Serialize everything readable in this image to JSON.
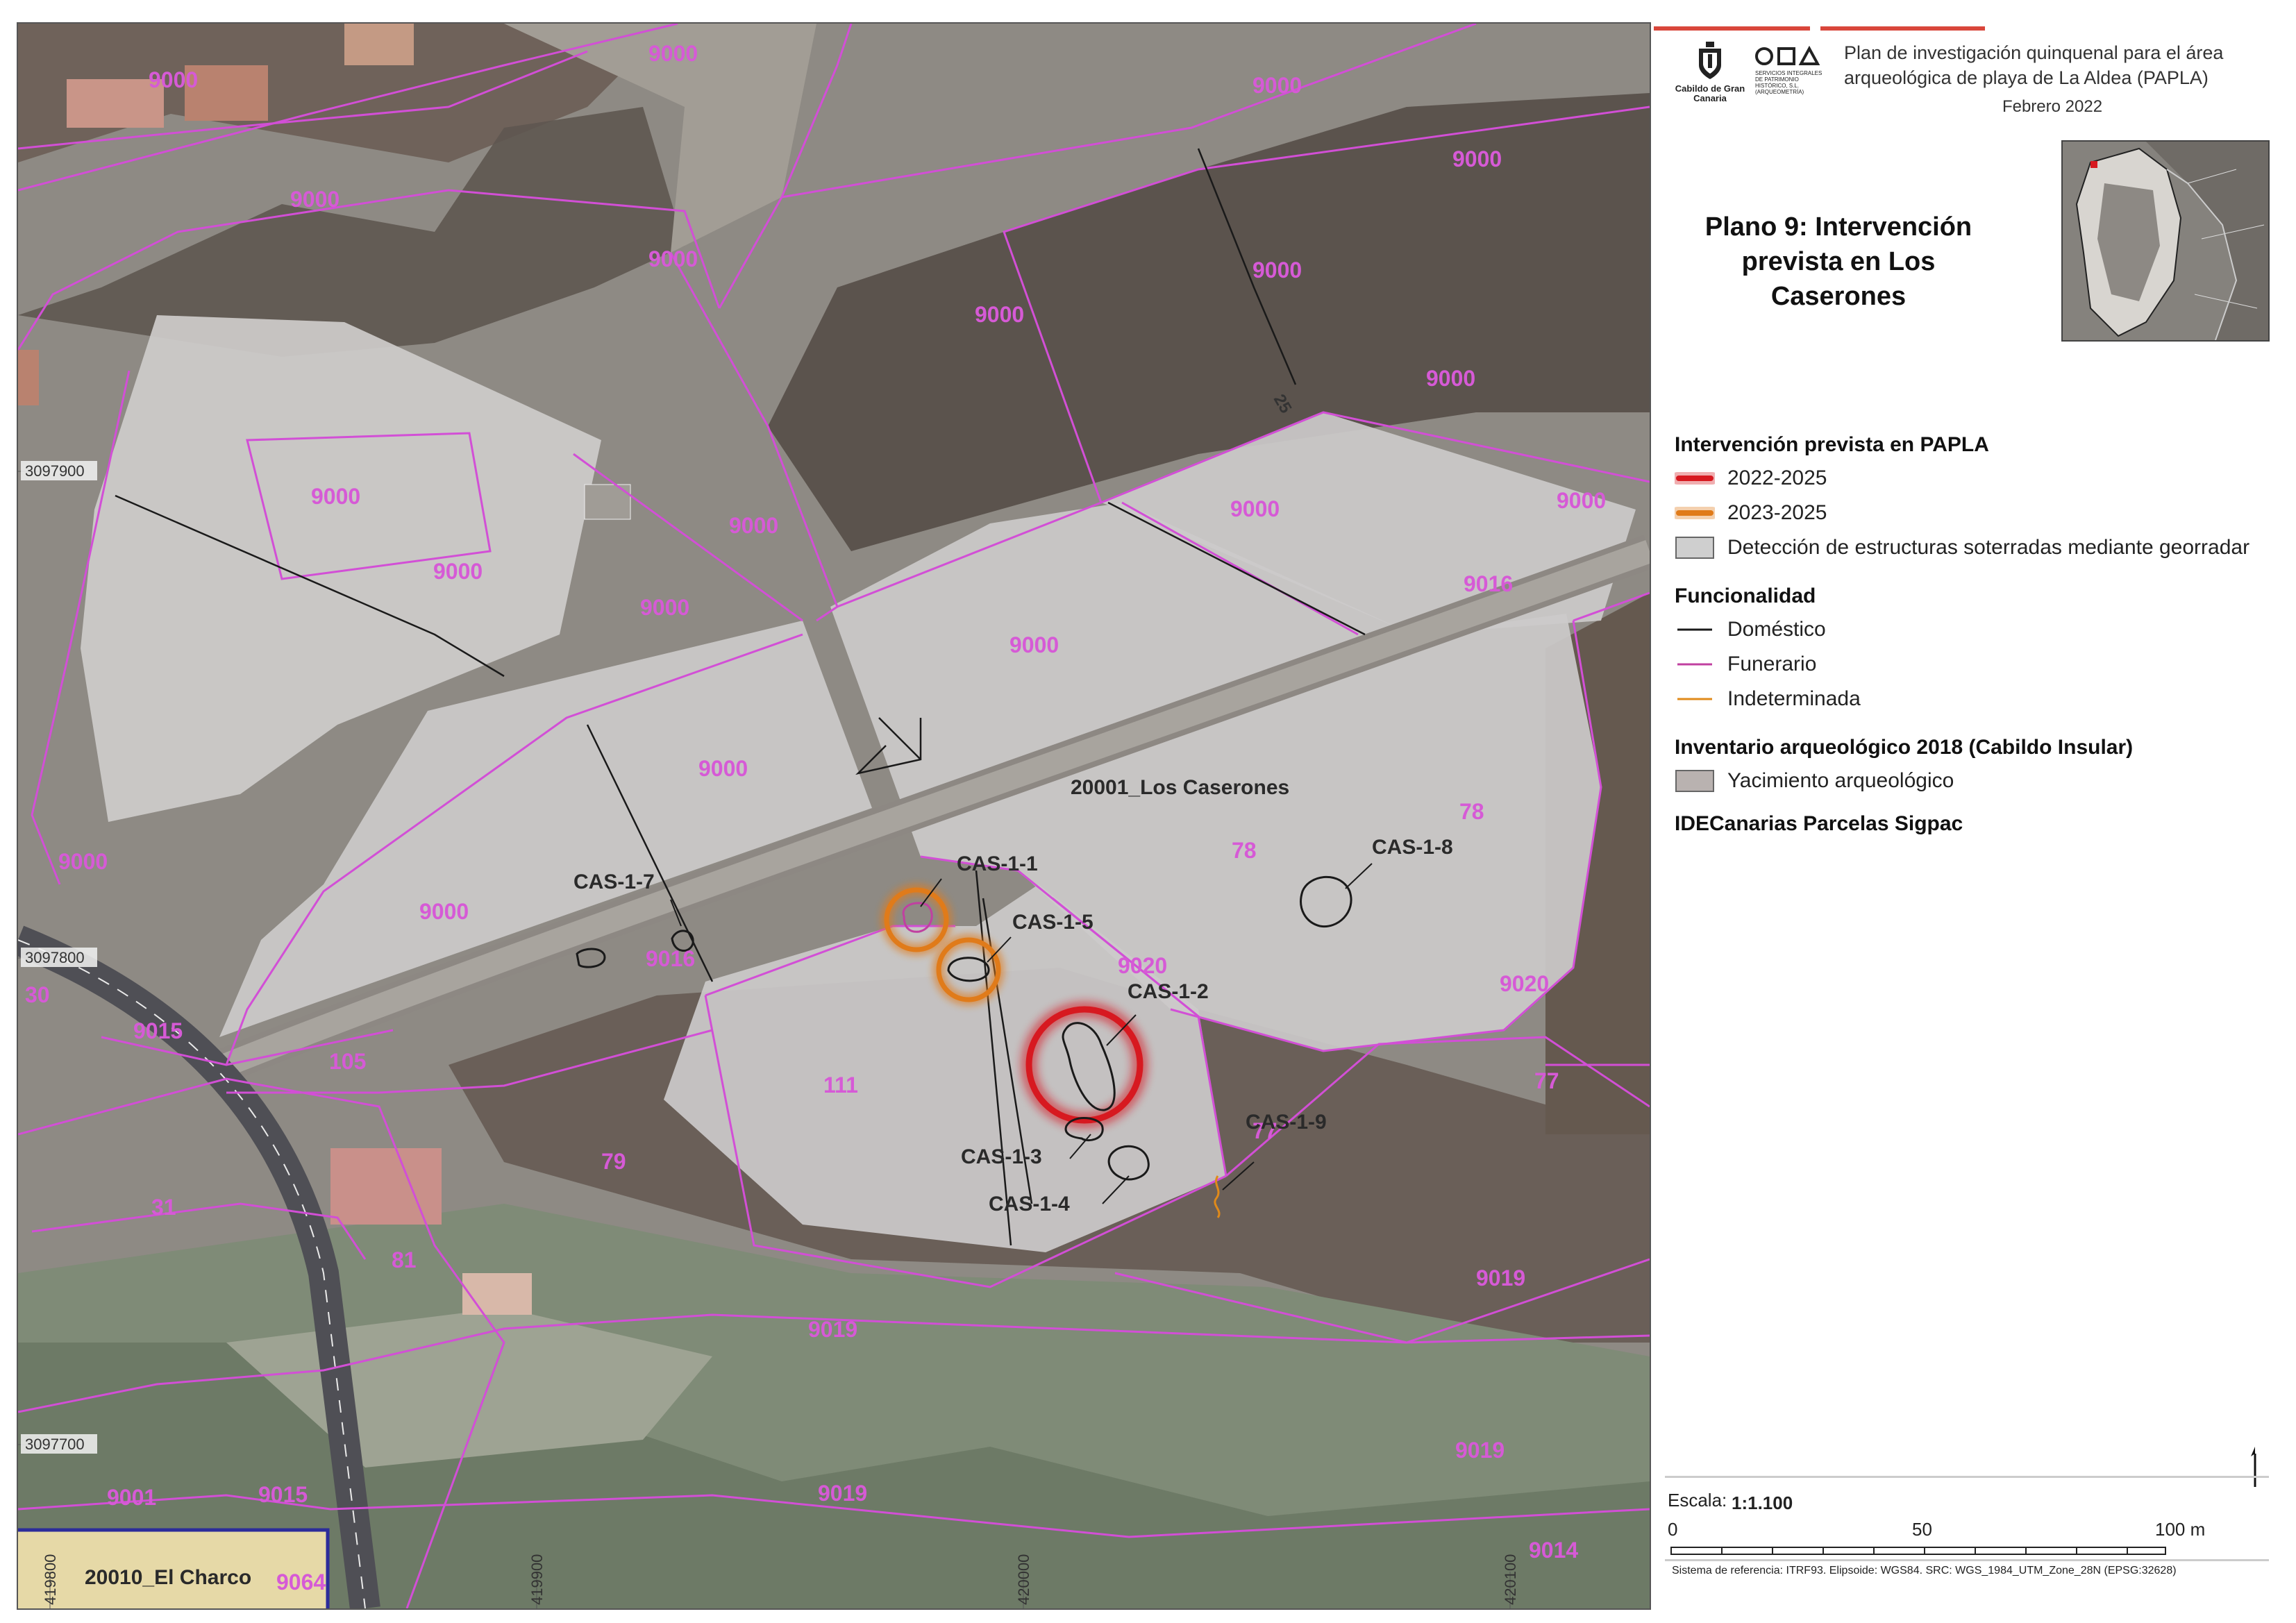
{
  "map": {
    "parcel_labels": [
      "9000",
      "9000",
      "9000",
      "9000",
      "9000",
      "9000",
      "9000",
      "9000",
      "9000",
      "9000",
      "9000",
      "9000",
      "9000",
      "9000",
      "9000",
      "9000",
      "9000",
      "9000",
      "9000",
      "9016",
      "9016",
      "9015",
      "9020",
      "9020",
      "9019",
      "9019",
      "9019",
      "9019",
      "9015",
      "9001",
      "9064",
      "9014",
      "78",
      "78",
      "77",
      "77",
      "111",
      "105",
      "79",
      "31",
      "81",
      "30",
      "25"
    ],
    "zone_labels": {
      "caserones": "20001_Los Caserones",
      "charco": "20010_El Charco"
    },
    "site_labels": [
      "CAS-1-1",
      "CAS-1-2",
      "CAS-1-3",
      "CAS-1-4",
      "CAS-1-5",
      "CAS-1-7",
      "CAS-1-8",
      "CAS-1-9"
    ],
    "coords": {
      "y1": "3097900",
      "y2": "3097800",
      "y3": "3097700",
      "x1": "419800",
      "x2": "419900",
      "x3": "420000",
      "x4": "420100"
    },
    "colors": {
      "parcel_line": "#d24fd6",
      "red": "#d71920",
      "orange": "#e07b1a",
      "domestic": "#1a1a1a",
      "funerario": "#c040a0",
      "indeterminada": "#e08a1a",
      "georadar": "#cfcfcf",
      "yacimiento": "#b9b2b0"
    }
  },
  "panel": {
    "logo_cabildo": "Cabildo de Gran Canaria",
    "logo_oda": "ODA",
    "logo_oda_sub": "SERVICIOS INTEGRALES DE PATRIMONIO HISTÓRICO, S.L. (ARQUEOMETRÍA)",
    "header_line1": "Plan de investigación quinquenal para el área",
    "header_line2": "arqueológica de playa de La Aldea (PAPLA)",
    "header_date": "Febrero 2022",
    "title_line1": "Plano 9:  Intervención",
    "title_line2": "prevista en Los Caserones",
    "legend": {
      "h1": "Intervención prevista en PAPLA",
      "i1": "2022-2025",
      "i2": "2023-2025",
      "i3": "Detección de estructuras soterradas mediante georradar",
      "h2": "Funcionalidad",
      "i4": "Doméstico",
      "i5": "Funerario",
      "i6": "Indeterminada",
      "h3": "Inventario arqueológico 2018 (Cabildo Insular)",
      "i7": "Yacimiento arqueológico",
      "h4": "IDECanarias Parcelas Sigpac"
    },
    "scale": {
      "label": "Escala:",
      "value": "1:1.100",
      "t0": "0",
      "t50": "50",
      "t100": "100 m"
    },
    "sref": "Sistema de referencia: ITRF93. Elipsoide: WGS84. SRC: WGS_1984_UTM_Zone_28N (EPSG:32628)"
  }
}
